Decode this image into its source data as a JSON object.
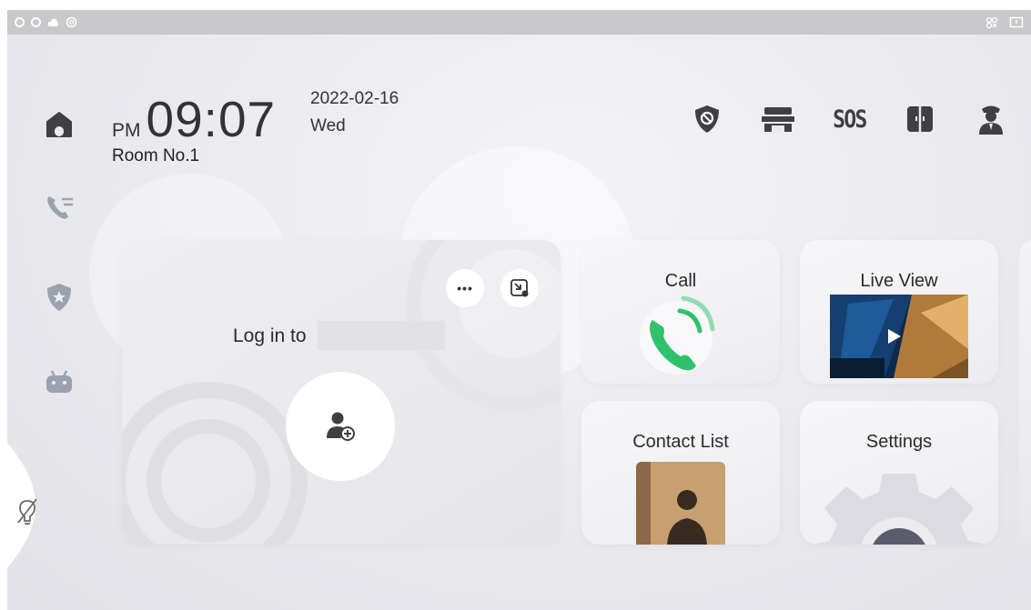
{
  "statusbar": {
    "left_icons": [
      "circle-icon",
      "circle-icon",
      "cloud-icon",
      "sync-icon"
    ],
    "right_icons": [
      "network-icon",
      "message-icon"
    ]
  },
  "sidebar": {
    "items": [
      {
        "name": "home-icon"
      },
      {
        "name": "call-log-icon"
      },
      {
        "name": "security-icon"
      },
      {
        "name": "android-icon"
      }
    ],
    "lamp_icon": "light-off-icon"
  },
  "header": {
    "ampm": "PM",
    "time": "09:07",
    "date": "2022-02-16",
    "weekday": "Wed",
    "room": "Room No.1"
  },
  "top_icons": [
    "arming-icon",
    "elevator-icon",
    "sos-icon",
    "door-icon",
    "guard-icon"
  ],
  "top_labels": {
    "sos": "SOS"
  },
  "login_card": {
    "text": "Log in to"
  },
  "tiles": {
    "call": "Call",
    "live_view": "Live View",
    "contact_list": "Contact List",
    "settings": "Settings"
  },
  "colors": {
    "accent_green": "#2fc26a",
    "icon_dark": "#3f3f44",
    "statusbar_bg": "#c9c9cb"
  }
}
